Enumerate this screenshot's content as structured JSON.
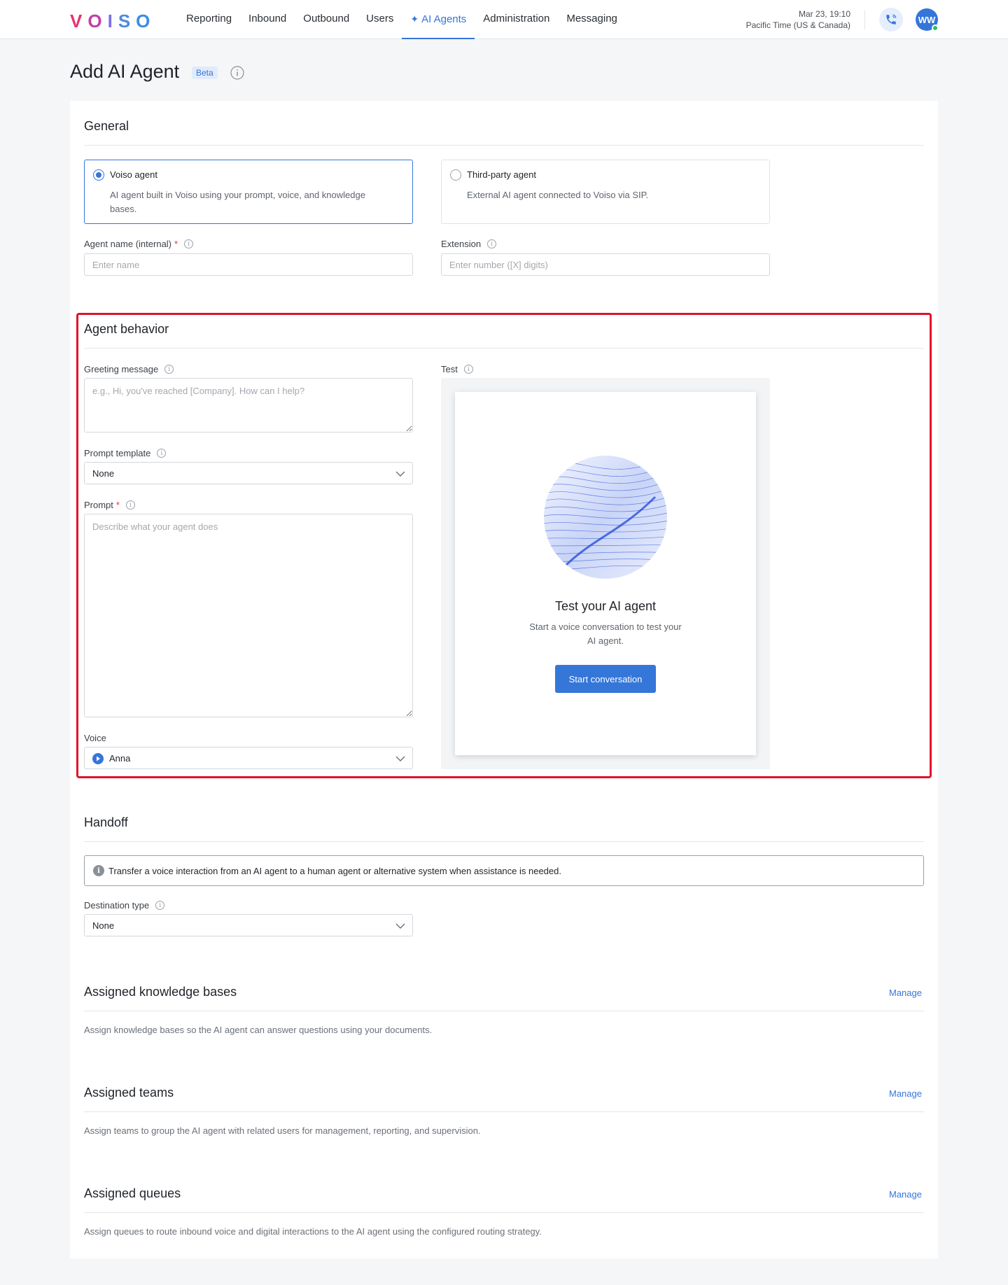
{
  "header": {
    "logo_text": "VOISO",
    "nav": [
      "Reporting",
      "Inbound",
      "Outbound",
      "Users",
      "AI Agents",
      "Administration",
      "Messaging"
    ],
    "active_nav": "AI Agents",
    "date": "Mar 23, 19:10",
    "timezone": "Pacific Time (US & Canada)",
    "avatar_initials": "WW"
  },
  "page": {
    "title": "Add AI Agent",
    "badge": "Beta"
  },
  "general": {
    "title": "General",
    "voiso_agent": {
      "title": "Voiso agent",
      "desc": "AI agent built in Voiso using your prompt, voice, and knowledge bases.",
      "selected": true
    },
    "third_party_agent": {
      "title": "Third-party agent",
      "desc": "External AI agent connected to Voiso via SIP.",
      "selected": false
    },
    "agent_name": {
      "label": "Agent name (internal)",
      "placeholder": "Enter name",
      "value": ""
    },
    "extension": {
      "label": "Extension",
      "placeholder": "Enter number ([X] digits)",
      "value": ""
    }
  },
  "behavior": {
    "title": "Agent behavior",
    "greeting": {
      "label": "Greeting message",
      "placeholder": "e.g., Hi, you've reached [Company]. How can I help?"
    },
    "prompt_template": {
      "label": "Prompt template",
      "value": "None"
    },
    "prompt": {
      "label": "Prompt",
      "placeholder": "Describe what your agent does"
    },
    "voice": {
      "label": "Voice",
      "value": "Anna"
    },
    "test": {
      "label": "Test",
      "heading": "Test your AI agent",
      "desc_line1": "Start a voice conversation to test your",
      "desc_line2": "AI agent.",
      "button": "Start conversation"
    }
  },
  "handoff": {
    "title": "Handoff",
    "notice": "Transfer a voice interaction from an AI agent to a human agent or alternative system when assistance is needed.",
    "destination": {
      "label": "Destination type",
      "value": "None"
    }
  },
  "knowledge_bases": {
    "title": "Assigned knowledge bases",
    "manage": "Manage",
    "desc": "Assign knowledge bases so the AI agent can answer questions using your documents."
  },
  "teams": {
    "title": "Assigned teams",
    "manage": "Manage",
    "desc": "Assign teams to group the AI agent with related users for management, reporting, and supervision."
  },
  "queues": {
    "title": "Assigned queues",
    "manage": "Manage",
    "desc": "Assign queues to route inbound voice and digital interactions to the AI agent using the configured routing strategy."
  },
  "colors": {
    "accent": "#3576d9",
    "highlight_border": "#e0132b",
    "required": "#e0343c"
  }
}
